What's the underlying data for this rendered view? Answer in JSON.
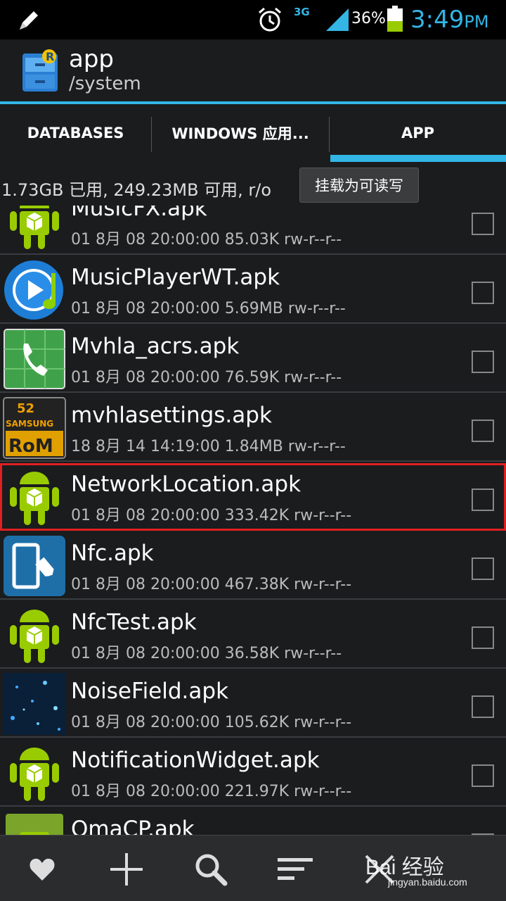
{
  "status_bar": {
    "network": "3G",
    "battery_percent": "36%",
    "time": "3:49",
    "time_suffix": "PM",
    "accent_color": "#33b5e5"
  },
  "header": {
    "title": "app",
    "path": "/system"
  },
  "tabs": [
    {
      "label": "DATABASES",
      "active": false
    },
    {
      "label": "WINDOWS 应用...",
      "active": false
    },
    {
      "label": "APP",
      "active": true
    }
  ],
  "storage": {
    "info": "1.73GB 已用, 249.23MB 可用, r/o",
    "remount_label": "挂载为可读写"
  },
  "files": [
    {
      "name": "MusicFX.apk",
      "meta": "01 8月 08 20:00:00  85.03K  rw-r--r--",
      "icon": "android-icon",
      "highlighted": false
    },
    {
      "name": "MusicPlayerWT.apk",
      "meta": "01 8月 08 20:00:00  5.69MB  rw-r--r--",
      "icon": "music-player-icon",
      "highlighted": false
    },
    {
      "name": "Mvhla_acrs.apk",
      "meta": "01 8月 08 20:00:00  76.59K  rw-r--r--",
      "icon": "phone-icon",
      "highlighted": false
    },
    {
      "name": "mvhlasettings.apk",
      "meta": "18 8月 14 14:19:00  1.84MB  rw-r--r--",
      "icon": "samsung-rom-icon",
      "highlighted": false
    },
    {
      "name": "NetworkLocation.apk",
      "meta": "01 8月 08 20:00:00  333.42K  rw-r--r--",
      "icon": "android-icon",
      "highlighted": true
    },
    {
      "name": "Nfc.apk",
      "meta": "01 8月 08 20:00:00  467.38K  rw-r--r--",
      "icon": "nfc-icon",
      "highlighted": false
    },
    {
      "name": "NfcTest.apk",
      "meta": "01 8月 08 20:00:00  36.58K  rw-r--r--",
      "icon": "android-icon",
      "highlighted": false
    },
    {
      "name": "NoiseField.apk",
      "meta": "01 8月 08 20:00:00  105.62K  rw-r--r--",
      "icon": "noisefield-icon",
      "highlighted": false
    },
    {
      "name": "NotificationWidget.apk",
      "meta": "01 8月 08 20:00:00  221.97K  rw-r--r--",
      "icon": "android-icon",
      "highlighted": false
    },
    {
      "name": "OmaCP.apk",
      "meta": "",
      "icon": "android-icon",
      "highlighted": false
    }
  ],
  "toolbar": {
    "icons": [
      "favorite-icon",
      "add-icon",
      "search-icon",
      "sort-icon",
      "close-icon"
    ],
    "watermark": "Bai 经验",
    "watermark_url": "jingyan.baidu.com"
  }
}
